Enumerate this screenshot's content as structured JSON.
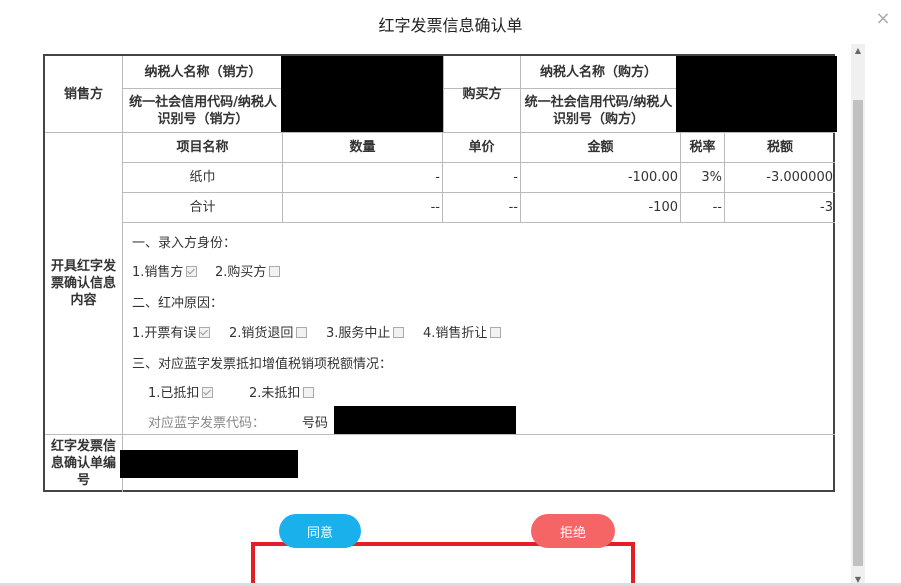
{
  "dialog": {
    "title": "红字发票信息确认单",
    "close_label": "×"
  },
  "seller": {
    "label": "销售方",
    "name_label": "纳税人名称（销方）",
    "id_label": "统一社会信用代码/纳税人识别号（销方）"
  },
  "buyer": {
    "label": "购买方",
    "name_label": "纳税人名称（购方）",
    "id_label": "统一社会信用代码/纳税人识别号（购方）"
  },
  "items": {
    "section_label": "开具红字发票确认信息内容",
    "headers": [
      "项目名称",
      "数量",
      "单价",
      "金额",
      "税率",
      "税额"
    ],
    "rows": [
      [
        "纸巾",
        "-",
        "-",
        "-100.00",
        "3%",
        "-3.000000"
      ],
      [
        "合计",
        "--",
        "--",
        "-100",
        "--",
        "-3"
      ]
    ]
  },
  "entry": {
    "heading": "一、录入方身份：",
    "options": [
      {
        "label": "1.销售方",
        "checked": true
      },
      {
        "label": "2.购买方",
        "checked": false
      }
    ]
  },
  "reason": {
    "heading": "二、红冲原因：",
    "options": [
      {
        "label": "1.开票有误",
        "checked": true
      },
      {
        "label": "2.销货退回",
        "checked": false
      },
      {
        "label": "3.服务中止",
        "checked": false
      },
      {
        "label": "4.销售折让",
        "checked": false
      }
    ]
  },
  "deduction": {
    "heading": "三、对应蓝字发票抵扣增值税销项税额情况：",
    "options": [
      {
        "label": "1.已抵扣",
        "checked": true
      },
      {
        "label": "2.未抵扣",
        "checked": false
      }
    ],
    "code_label": "对应蓝字发票代码：",
    "number_label": "号码"
  },
  "confirmation": {
    "label": "红字发票信息确认单编号"
  },
  "actions": {
    "agree": "同意",
    "reject": "拒绝",
    "agree_color": "#1ab0ec",
    "reject_color": "#f56565",
    "highlight_color": "#e41e25"
  },
  "scrollbar": {
    "up": "▲",
    "down": "▼"
  }
}
